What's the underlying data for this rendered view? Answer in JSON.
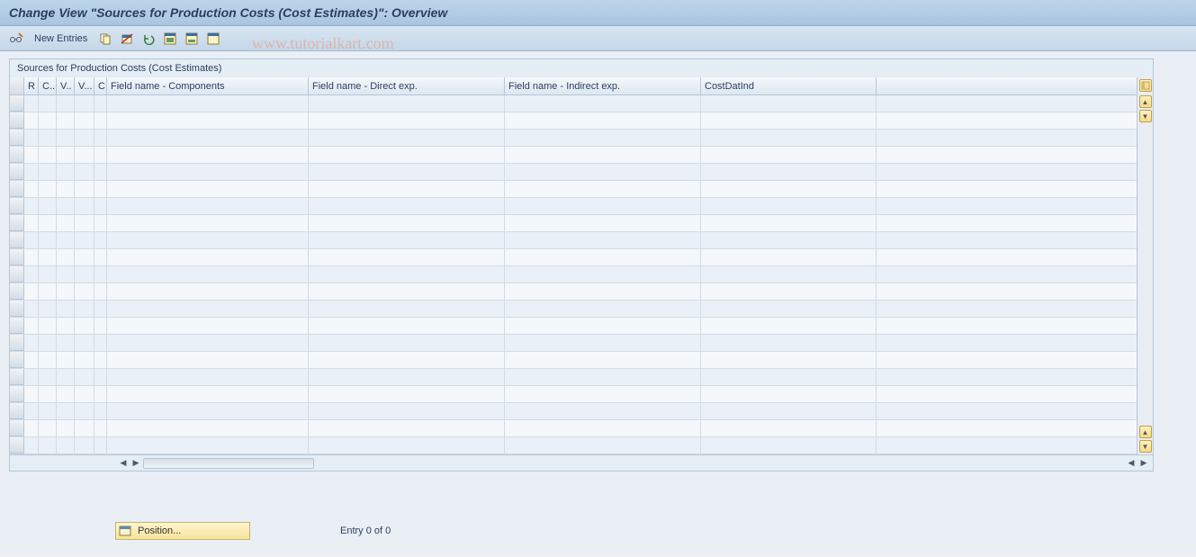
{
  "title": "Change View \"Sources for Production Costs (Cost Estimates)\": Overview",
  "toolbar": {
    "new_entries": "New Entries"
  },
  "watermark": "www.tutorialkart.com",
  "grid": {
    "title": "Sources for Production Costs (Cost Estimates)",
    "columns": {
      "r": "R",
      "c1": "C..",
      "v1": "V..",
      "v2": "V...",
      "c2": "C",
      "components": "Field name - Components",
      "direct": "Field name - Direct exp.",
      "indirect": "Field name - Indirect exp.",
      "costdat": "CostDatInd"
    }
  },
  "footer": {
    "position_label": "Position...",
    "entry_text": "Entry 0 of 0"
  }
}
